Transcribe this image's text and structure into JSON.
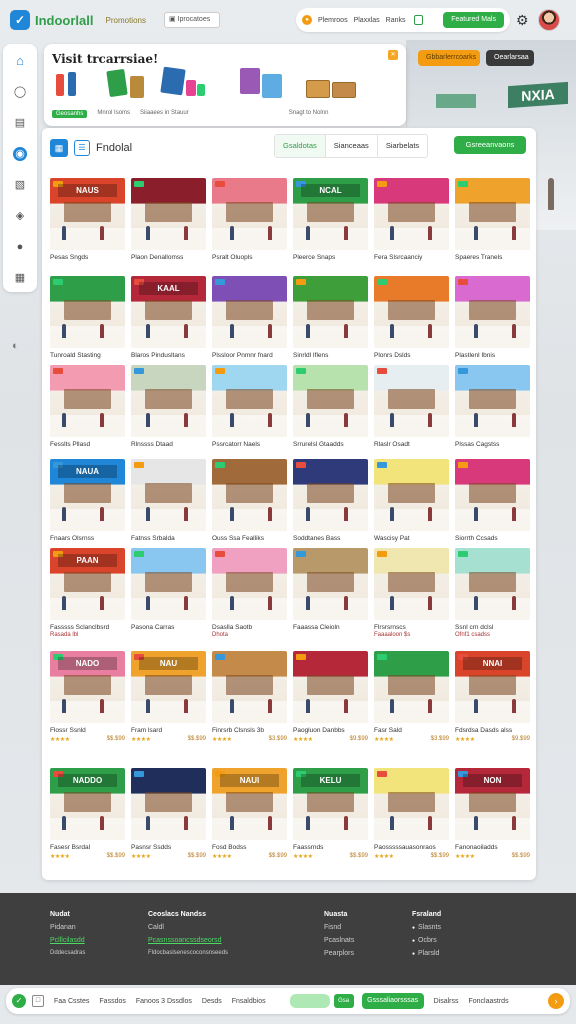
{
  "app": {
    "logo_text": "Indoorlall",
    "nav_link": "Promotions",
    "search_label": "Iprocatoes"
  },
  "top_pill": {
    "links": [
      "Plemroos",
      "Plaxxlas",
      "Ranks"
    ],
    "button": "Featured Mals"
  },
  "banner": {
    "title": "Visit trcarrsiae!",
    "labels": [
      "Geosanhs",
      "Mnrol Isoms",
      "Siiaaees in Stauur",
      "Snagt to Nolnn"
    ]
  },
  "top_actions": {
    "orange": "Gbbarlerrcoarks",
    "dark": "Oearlarsaa"
  },
  "main": {
    "title": "Fndolal",
    "tabs": [
      "Gsaldotas",
      "Sianceaas",
      "Siarbelats"
    ],
    "button": "Gsreeanvaons"
  },
  "grid_rows": [
    [
      {
        "label": "Pesas Sngds",
        "theme": "#d9442b",
        "sign": "NAUS"
      },
      {
        "label": "Plaon Denallomss",
        "theme": "#8a1f2b",
        "sign": ""
      },
      {
        "label": "Psralt Oluopls",
        "theme": "#e97a8a",
        "sign": ""
      },
      {
        "label": "Pleerce Snaps",
        "theme": "#2e9e49",
        "sign": "NCAL"
      },
      {
        "label": "Fera Slsrcaanciy",
        "theme": "#d8397a",
        "sign": ""
      },
      {
        "label": "Spaeres Tranels",
        "theme": "#f0a32c",
        "sign": ""
      }
    ],
    [
      {
        "label": "Tunroald Stasting",
        "theme": "#2e9e49",
        "sign": ""
      },
      {
        "label": "Blaros Pindusltans",
        "theme": "#b5283a",
        "sign": "KAAL"
      },
      {
        "label": "Plssloor Pnmnr fnard",
        "theme": "#7e4fb5",
        "sign": ""
      },
      {
        "label": "Sinrldl Iflens",
        "theme": "#3e9e3a",
        "sign": ""
      },
      {
        "label": "Plonrs Dslds",
        "theme": "#e87b2a",
        "sign": ""
      },
      {
        "label": "Plastlenl Ibnis",
        "theme": "#d86ad0",
        "sign": ""
      }
    ],
    [
      {
        "label": "Fesslts Pllasd",
        "theme": "#f39bb0",
        "sign": ""
      },
      {
        "label": "Rlnssss Dtaad",
        "theme": "#c8d6c0",
        "sign": ""
      },
      {
        "label": "Pssrcatorr Naels",
        "theme": "#9fd6f0",
        "sign": ""
      },
      {
        "label": "Srrurelsl Gtaadds",
        "theme": "#b7e2ae",
        "sign": ""
      },
      {
        "label": "Rlaslr Osadt",
        "theme": "#e6eef2",
        "sign": ""
      },
      {
        "label": "Plssas Cagstss",
        "theme": "#8ac7f0",
        "sign": ""
      }
    ],
    [
      {
        "label": "Fnaars Olsrnss",
        "theme": "#1f86d8",
        "sign": "NAUA"
      },
      {
        "label": "Fatnss Srbalda",
        "theme": "#e6e6e6",
        "sign": ""
      },
      {
        "label": "Ouss Ssa Fealliks",
        "theme": "#a06a3a",
        "sign": ""
      },
      {
        "label": "Soddtanes Bass",
        "theme": "#2f3a7a",
        "sign": ""
      },
      {
        "label": "Wascisy Pat",
        "theme": "#f2e47a",
        "sign": ""
      },
      {
        "label": "Siorrth Ccsads",
        "theme": "#d8397a",
        "sign": ""
      }
    ],
    [
      {
        "label": "Fasssss Sclanclbsrd",
        "sub": "Rasada  lbl",
        "theme": "#d9442b",
        "sign": "PAAN"
      },
      {
        "label": "Pasona Carras",
        "sub": "",
        "theme": "#8ac7f0",
        "sign": ""
      },
      {
        "label": "Dsaslla Saotb",
        "sub": "Dhota",
        "theme": "#f0a0c0",
        "sign": ""
      },
      {
        "label": "Faaassa Cleioln",
        "sub": "",
        "theme": "#b89a6a",
        "sign": ""
      },
      {
        "label": "Flrsrsrnscs",
        "sub": "Faaaaloon  $s",
        "theme": "#f0e6b0",
        "sign": ""
      },
      {
        "label": "Ssnl crn dclsl",
        "sub": "Ofnf1 csadss",
        "theme": "#a6e0d0",
        "sign": ""
      }
    ],
    [
      {
        "label": "Flossr Ssnld",
        "stars": "★★★★",
        "price": "$$.$99",
        "theme": "#e87fa0",
        "sign": "NADO"
      },
      {
        "label": "Fram lsard",
        "stars": "★★★★",
        "price": "$$.$99",
        "theme": "#f0a32c",
        "sign": "NAU"
      },
      {
        "label": "Finrsrb Clsnsls 3b",
        "stars": "★★★★",
        "price": "$3.$99",
        "theme": "#c48a4a",
        "sign": ""
      },
      {
        "label": "Paogluon Danbbs",
        "stars": "★★★★",
        "price": "$9.$99",
        "theme": "#b5283a",
        "sign": ""
      },
      {
        "label": "Fasr Sald",
        "stars": "★★★★",
        "price": "$3.$99",
        "theme": "#2e9e49",
        "sign": ""
      },
      {
        "label": "Fdsrdsa Dasds alss",
        "stars": "★★★★",
        "price": "$9.$99",
        "theme": "#d9442b",
        "sign": "NNAI"
      }
    ],
    [
      {
        "label": "Fasesr Bsrdal",
        "stars": "★★★★",
        "price": "$$.$99",
        "theme": "#2e9e49",
        "sign": "NADDO"
      },
      {
        "label": "Pasnsr Ssdds",
        "stars": "★★★★",
        "price": "$$.$99",
        "theme": "#1f2e5a",
        "sign": ""
      },
      {
        "label": "Fosd Bodss",
        "stars": "★★★★",
        "price": "$$.$99",
        "theme": "#f0a32c",
        "sign": "NAUI"
      },
      {
        "label": "Faassrnds",
        "stars": "★★★★",
        "price": "$$.$99",
        "theme": "#2e9e49",
        "sign": "KELU"
      },
      {
        "label": "Paosssssauasonraos",
        "stars": "★★★★",
        "price": "$$.$99",
        "theme": "#f2e47a",
        "sign": ""
      },
      {
        "label": "Fanonaoiladds",
        "stars": "★★★★",
        "price": "$$.$99",
        "theme": "#b5283a",
        "sign": "NON"
      }
    ]
  ],
  "footer": {
    "col1": {
      "heading": "Nudat",
      "links": [
        "Pidanan",
        "Pclllcilasdd",
        "Dddecsadras"
      ]
    },
    "col2": {
      "heading": "Ceoslacs Nandss",
      "links": [
        "Caldl",
        "Pcasnssoancssdseorsd",
        "Fldocbaslsenescoconsnseeds"
      ]
    },
    "col3": {
      "heading": "Nuasta",
      "links": [
        "Fisnd",
        "Pcaslnats",
        "Pearplors"
      ]
    },
    "col4": {
      "heading": "Fsraland",
      "links": [
        "Slasnts",
        "Ocbrs",
        "Plarsld"
      ]
    }
  },
  "bottombar": {
    "links": [
      "Faa Csstes",
      "Fassdos",
      "Fanoos 3 Dssdlos",
      "Desds",
      "Fnsaldbios"
    ],
    "small_btn": "Gsa",
    "button": "Gsssaliaorsssas",
    "right_links": [
      "Disalrss",
      "Fonclaastrds"
    ]
  }
}
